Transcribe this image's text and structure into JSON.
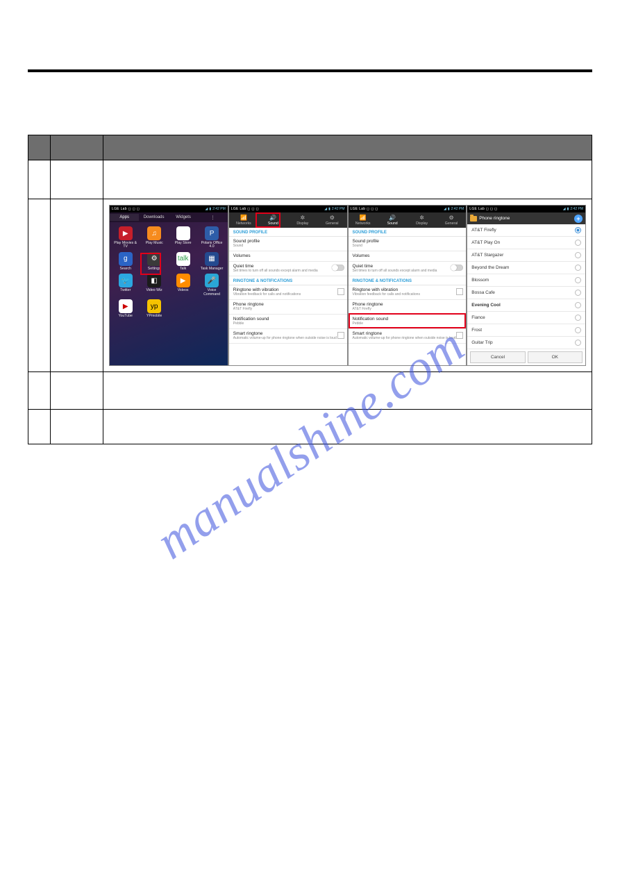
{
  "statusbar": {
    "left": "LGE Lab  ◻ ◻ ◻",
    "time": "2:42 PM"
  },
  "shot1": {
    "tabs": [
      "Apps",
      "Downloads",
      "Widgets"
    ],
    "apps": [
      {
        "label": "Play Movies & TV",
        "color": "#c61f2a",
        "glyph": "▶"
      },
      {
        "label": "Play Music",
        "color": "#f68b1e",
        "glyph": "♫"
      },
      {
        "label": "Play Store",
        "color": "#fff",
        "glyph": "▶"
      },
      {
        "label": "Polaris Office 4.0",
        "color": "#2e5da8",
        "glyph": "P"
      },
      {
        "label": "Search",
        "color": "#2b64c5",
        "glyph": "g"
      },
      {
        "label": "Settings",
        "color": "#3a3a3a",
        "glyph": "⚙"
      },
      {
        "label": "Talk",
        "color": "#fff",
        "glyph": "talk",
        "txtcolor": "#2e9e4a"
      },
      {
        "label": "Task Manager",
        "color": "#244a8f",
        "glyph": "▦"
      },
      {
        "label": "Twitter",
        "color": "#2ca7e0",
        "glyph": "🐦"
      },
      {
        "label": "Video Wiz",
        "color": "#1b1b1b",
        "glyph": "◧"
      },
      {
        "label": "Videos",
        "color": "#ff8c00",
        "glyph": "▶"
      },
      {
        "label": "Voice Command",
        "color": "#2aa6d6",
        "glyph": "🎤"
      },
      {
        "label": "YouTube",
        "color": "#fff",
        "glyph": "▶",
        "txtcolor": "#c00"
      },
      {
        "label": "YPmobile",
        "color": "#f6c300",
        "glyph": "yp",
        "txtcolor": "#000"
      }
    ]
  },
  "settings": {
    "tabs": [
      {
        "label": "Networks",
        "glyph": "📶"
      },
      {
        "label": "Sound",
        "glyph": "🔊"
      },
      {
        "label": "Display",
        "glyph": "✲"
      },
      {
        "label": "General",
        "glyph": "⚙"
      }
    ],
    "section1": "SOUND PROFILE",
    "section2": "RINGTONE & NOTIFICATIONS",
    "items": [
      {
        "t": "Sound profile",
        "s": "Sound"
      },
      {
        "t": "Volumes",
        "s": ""
      },
      {
        "t": "Quiet time",
        "s": "Set times to turn off all sounds except alarm and media",
        "toggle": true
      },
      {
        "t": "Ringtone with vibration",
        "s": "Vibration feedback for calls and notifications",
        "chk": true
      },
      {
        "t": "Phone ringtone",
        "s": "AT&T Firefly"
      },
      {
        "t": "Notification sound",
        "s": "Pebble"
      },
      {
        "t": "Smart ringtone",
        "s": "Automatic volume-up for phone ringtone when outside noise is loud",
        "chk": true
      }
    ]
  },
  "ringtone": {
    "title": "Phone ringtone",
    "items": [
      {
        "label": "AT&T Firefly",
        "on": true
      },
      {
        "label": "AT&T Play On",
        "on": false
      },
      {
        "label": "AT&T Stargazer",
        "on": false
      },
      {
        "label": "Beyond the Dream",
        "on": false
      },
      {
        "label": "Blossom",
        "on": false
      },
      {
        "label": "Bossa Cafe",
        "on": false
      },
      {
        "label": "Evening Cool",
        "on": false,
        "sel": true
      },
      {
        "label": "Fiance",
        "on": false
      },
      {
        "label": "Frost",
        "on": false
      },
      {
        "label": "Guitar Trip",
        "on": false
      }
    ],
    "cancel": "Cancel",
    "ok": "OK"
  },
  "watermark": "manualshine.com"
}
